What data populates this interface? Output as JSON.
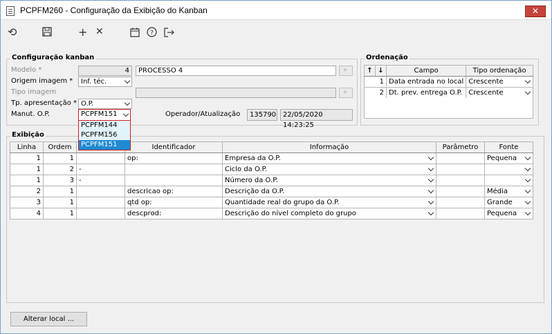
{
  "window": {
    "title": "PCPFM260 - Configuração da Exibição do Kanban",
    "close_label": "✕"
  },
  "toolbar": {
    "refresh": "⟲",
    "save": "💾",
    "add": "+",
    "remove": "✕",
    "calendar": "📅",
    "help": "?",
    "exit": "⇥"
  },
  "config": {
    "title": "Configuração kanban",
    "modelo_label": "Modelo *",
    "modelo_value": "4",
    "modelo_desc": "PROCESSO 4",
    "origem_label": "Origem imagem *",
    "origem_value": "Inf. téc.",
    "tipo_label": "Tipo imagem",
    "tp_label": "Tp. apresentação *",
    "tp_value": "O.P.",
    "manut_label": "Manut. O.P.",
    "manut_value": "PCPFM151",
    "operador_label": "Operador/Atualização",
    "operador_value": "135790",
    "data_value": "22/05/2020 14:23:25",
    "dropdown_options": [
      "PCPFM144",
      "PCPFM156",
      "PCPFM151"
    ]
  },
  "ordenacao": {
    "title": "Ordenação",
    "headers": [
      "↑",
      "↓",
      "Campo",
      "Tipo ordenação"
    ],
    "rows": [
      {
        "n": "1",
        "campo": "Data entrada no local",
        "tipo": "Crescente"
      },
      {
        "n": "2",
        "campo": "Dt. prev. entrega O.P.",
        "tipo": "Crescente"
      }
    ]
  },
  "exibicao": {
    "title": "Exibição",
    "headers": [
      "Linha",
      "Ordem",
      "",
      "Identificador",
      "Informação",
      "Parâmetro",
      "Fonte"
    ],
    "rows": [
      {
        "linha": "1",
        "ordem": "1",
        "sep": "",
        "ident": "op:",
        "info": "Empresa da O.P.",
        "param": "",
        "fonte": "Pequena"
      },
      {
        "linha": "1",
        "ordem": "2",
        "sep": "-",
        "ident": "",
        "info": "Ciclo da O.P.",
        "param": "",
        "fonte": ""
      },
      {
        "linha": "1",
        "ordem": "3",
        "sep": "-",
        "ident": "",
        "info": "Número da O.P.",
        "param": "",
        "fonte": ""
      },
      {
        "linha": "2",
        "ordem": "1",
        "sep": "",
        "ident": "descricao op:",
        "info": "Descrição da O.P.",
        "param": "",
        "fonte": "Média"
      },
      {
        "linha": "3",
        "ordem": "1",
        "sep": "",
        "ident": "qtd op:",
        "info": "Quantidade real do grupo da O.P.",
        "param": "",
        "fonte": "Grande"
      },
      {
        "linha": "4",
        "ordem": "1",
        "sep": "",
        "ident": "descprod:",
        "info": "Descrição do nível completo do grupo",
        "param": "",
        "fonte": "Pequena"
      }
    ]
  },
  "footer": {
    "alterar_label": "Alterar local ..."
  }
}
